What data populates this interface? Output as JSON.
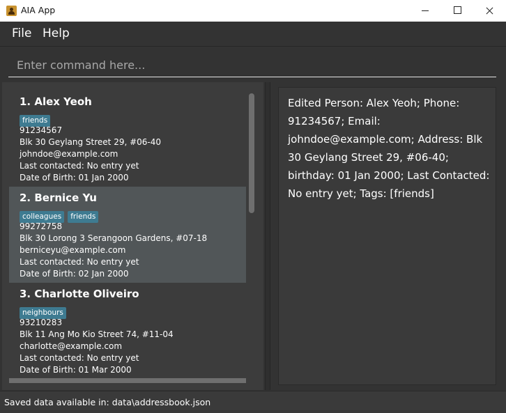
{
  "window": {
    "title": "AIA App"
  },
  "menu": {
    "file": "File",
    "help": "Help"
  },
  "command": {
    "placeholder": "Enter command here..."
  },
  "persons": [
    {
      "name": "1.  Alex Yeoh",
      "tags": [
        "friends"
      ],
      "phone": "91234567",
      "address": "Blk 30 Geylang Street 29, #06-40",
      "email": "johndoe@example.com",
      "last_contacted": "Last contacted: No entry yet",
      "dob": "Date of Birth: 01 Jan 2000"
    },
    {
      "name": "2.  Bernice Yu",
      "tags": [
        "colleagues",
        "friends"
      ],
      "phone": "99272758",
      "address": "Blk 30 Lorong 3 Serangoon Gardens, #07-18",
      "email": "berniceyu@example.com",
      "last_contacted": "Last contacted: No entry yet",
      "dob": "Date of Birth: 02 Jan 2000"
    },
    {
      "name": "3.  Charlotte Oliveiro",
      "tags": [
        "neighbours"
      ],
      "phone": "93210283",
      "address": "Blk 11 Ang Mo Kio Street 74, #11-04",
      "email": "charlotte@example.com",
      "last_contacted": "Last contacted: No entry yet",
      "dob": "Date of Birth: 01 Mar 2000"
    }
  ],
  "result": {
    "text": "Edited Person: Alex Yeoh; Phone: 91234567; Email: johndoe@example.com; Address: Blk 30 Geylang Street 29, #06-40; birthday: 01 Jan 2000; Last Contacted: No entry yet; Tags: [friends]"
  },
  "status": {
    "text": "Saved data available in: data\\addressbook.json"
  },
  "colors": {
    "tag": "#3e7b91",
    "selected_card": "#515658",
    "background": "#333333"
  }
}
